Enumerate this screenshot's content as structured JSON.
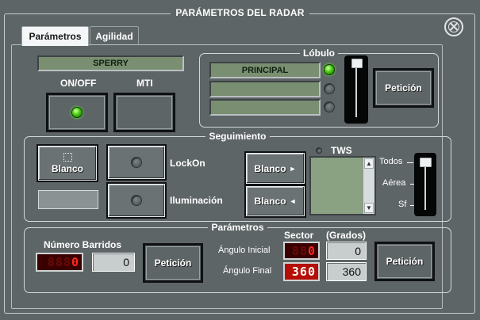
{
  "window": {
    "title": "PARÁMETROS DEL RADAR"
  },
  "tabs": [
    {
      "label": "Parámetros"
    },
    {
      "label": "Agilidad"
    }
  ],
  "radar": {
    "name": "SPERRY",
    "on_off_label": "ON/OFF",
    "mti_label": "MTI"
  },
  "lobulo": {
    "title": "Lóbulo",
    "rows": [
      {
        "value": "PRINCIPAL",
        "led": "green"
      },
      {
        "value": "",
        "led": "off"
      },
      {
        "value": "",
        "led": "off"
      }
    ],
    "slider_level": 1.0,
    "request_label": "Petición"
  },
  "seguimiento": {
    "title": "Seguimiento",
    "blanco_label": "Blanco",
    "lockon_label": "LockOn",
    "iluminacion_label": "Iluminación",
    "tws_label": "TWS",
    "blanco_next_label": "Blanco",
    "blanco_prev_label": "Blanco",
    "filter_options": [
      "Todos",
      "Aérea",
      "Sf"
    ],
    "filter_selected": "Todos"
  },
  "parametros": {
    "title": "Parámetros",
    "barridos_label": "Número Barridos",
    "barridos_led": {
      "ghost": "888",
      "value": "0"
    },
    "barridos_value": "0",
    "barridos_request_label": "Petición",
    "sector_label": "Sector",
    "grados_label": "(Grados)",
    "angulo_inicial_label": "Ángulo Inicial",
    "angulo_inicial_led": {
      "ghost": "88",
      "value": "0"
    },
    "angulo_inicial_value": "0",
    "angulo_final_label": "Ángulo Final",
    "angulo_final_led": {
      "ghost": "",
      "value": "360"
    },
    "angulo_final_value": "360",
    "sector_request_label": "Petición"
  },
  "colors": {
    "panel_bg": "#5e6567",
    "lcd_green": "#7a8e72",
    "led_green": "#4cd616",
    "segment_red": "#ff2a1a"
  },
  "icons": {
    "close": "close-circle-icon",
    "next": "chevron-right-icon",
    "prev": "chevron-left-icon",
    "focus": "dotted-focus-icon"
  }
}
